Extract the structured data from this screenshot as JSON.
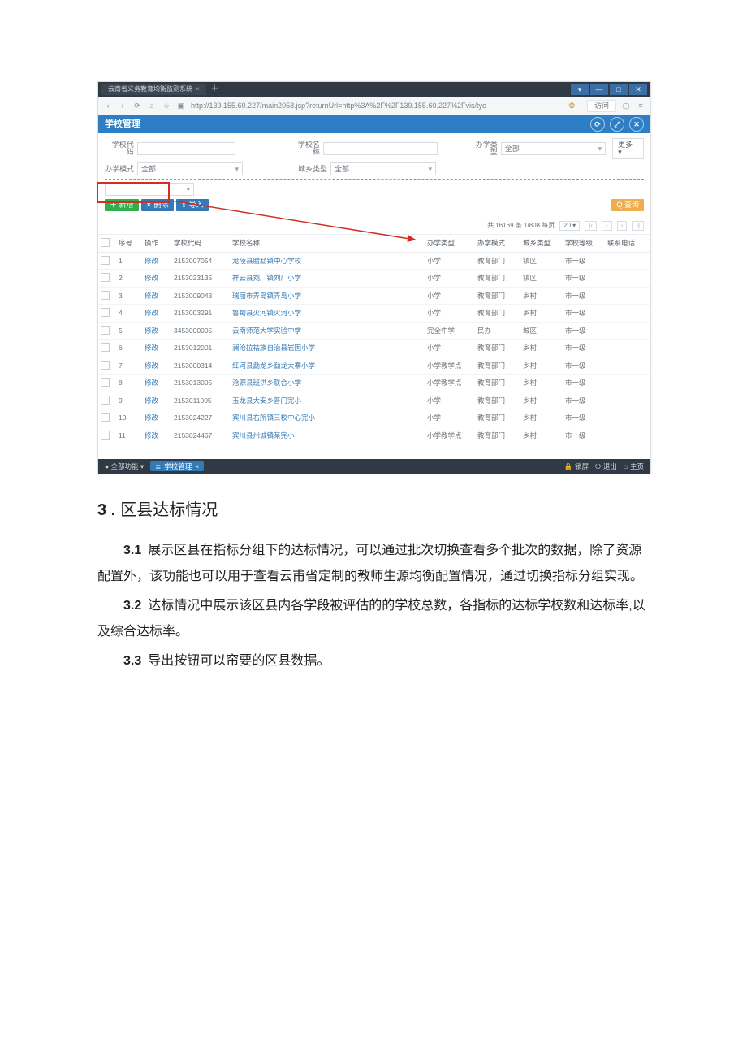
{
  "browser": {
    "tab_title": "云南省义务教育均衡监测系统",
    "url": "http://139.155.60.227/main2058.jsp?returnUrl=http%3A%2F%2F139.155.60.227%2Fvis/tye",
    "addr_action": "访问",
    "win_min": "—",
    "win_max": "□",
    "win_close": "✕"
  },
  "panel": {
    "title": "学校管理"
  },
  "filters": {
    "code_label": "学校代码",
    "name_label": "学校名称",
    "stage_label": "办学类型",
    "stage_value": "全部",
    "mode_label": "办学模式",
    "mode_value": "全部",
    "area_label": "城乡类型",
    "area_value": "全部",
    "extra_btn": "更多 ▾"
  },
  "buttons": {
    "add": "＋ 新增",
    "del": "✕ 删除",
    "imp": "⇪ 导入",
    "search": "Q 查询"
  },
  "pager": {
    "summary": "共 16169 条 1/808 每页",
    "size": "20",
    "first": "|‹",
    "prev": "‹",
    "next": "›",
    "last": "›|"
  },
  "columns": {
    "chk": "",
    "idx": "序号",
    "op": "操作",
    "code": "学校代码",
    "name": "学校名称",
    "stage": "办学类型",
    "mode": "办学模式",
    "area": "城乡类型",
    "level": "学校等级",
    "phone": "联系电话"
  },
  "op_label": "修改",
  "rows": [
    {
      "idx": "1",
      "code": "2153007054",
      "name": "龙陵县腊勐镇中心学校",
      "stage": "小学",
      "mode": "教育部门",
      "area": "镇区",
      "level": "市一级",
      "phone": ""
    },
    {
      "idx": "2",
      "code": "2153023135",
      "name": "祥云县刘厂镇刘厂小学",
      "stage": "小学",
      "mode": "教育部门",
      "area": "镇区",
      "level": "市一级",
      "phone": ""
    },
    {
      "idx": "3",
      "code": "2153009043",
      "name": "瑞丽市弄岛镇弄岛小学",
      "stage": "小学",
      "mode": "教育部门",
      "area": "乡村",
      "level": "市一级",
      "phone": ""
    },
    {
      "idx": "4",
      "code": "2153003291",
      "name": "鲁甸县火河镇火河小学",
      "stage": "小学",
      "mode": "教育部门",
      "area": "乡村",
      "level": "市一级",
      "phone": ""
    },
    {
      "idx": "5",
      "code": "3453000005",
      "name": "云南师范大学实验中学",
      "stage": "完全中学",
      "mode": "民办",
      "area": "城区",
      "level": "市一级",
      "phone": ""
    },
    {
      "idx": "6",
      "code": "2153012001",
      "name": "澜沧拉祜族自治县岩因小学",
      "stage": "小学",
      "mode": "教育部门",
      "area": "乡村",
      "level": "市一级",
      "phone": ""
    },
    {
      "idx": "7",
      "code": "2153000314",
      "name": "红河县勐龙乡勐龙大寨小学",
      "stage": "小学教学点",
      "mode": "教育部门",
      "area": "乡村",
      "level": "市一级",
      "phone": ""
    },
    {
      "idx": "8",
      "code": "2153013005",
      "name": "沧源县班洪乡联合小学",
      "stage": "小学教学点",
      "mode": "教育部门",
      "area": "乡村",
      "level": "市一级",
      "phone": ""
    },
    {
      "idx": "9",
      "code": "2153011005",
      "name": "玉龙县大安乡普门完小",
      "stage": "小学",
      "mode": "教育部门",
      "area": "乡村",
      "level": "市一级",
      "phone": ""
    },
    {
      "idx": "10",
      "code": "2153024227",
      "name": "宾川县右所镇三校中心完小",
      "stage": "小学",
      "mode": "教育部门",
      "area": "乡村",
      "level": "市一级",
      "phone": ""
    },
    {
      "idx": "11",
      "code": "2153024467",
      "name": "宾川县州城镇某完小",
      "stage": "小学教学点",
      "mode": "教育部门",
      "area": "乡村",
      "level": "市一级",
      "phone": ""
    }
  ],
  "statusbar": {
    "all_closed": "● 全部功能 ▾",
    "current": "学校管理",
    "lock": "锁屏",
    "logout": "退出",
    "home": "主页"
  },
  "doc": {
    "sec_num": "3 .",
    "sec_title": "区县达标情况",
    "p1_num": "3.1",
    "p1": "展示区县在指标分组下的达标情况，可以通过批次切换查看多个批次的数据，除了资源配置外，该功能也可以用于查看云甫省定制的教师生源均衡配置情况，通过切换指标分组实现。",
    "p2_num": "3.2",
    "p2": "达标情况中展示该区县内各学段被评估的的学校总数，各指标的达标学校数和达标率,以及综合达标率。",
    "p3_num": "3.3",
    "p3": "导出按钮可以帘要的区县数据。"
  }
}
